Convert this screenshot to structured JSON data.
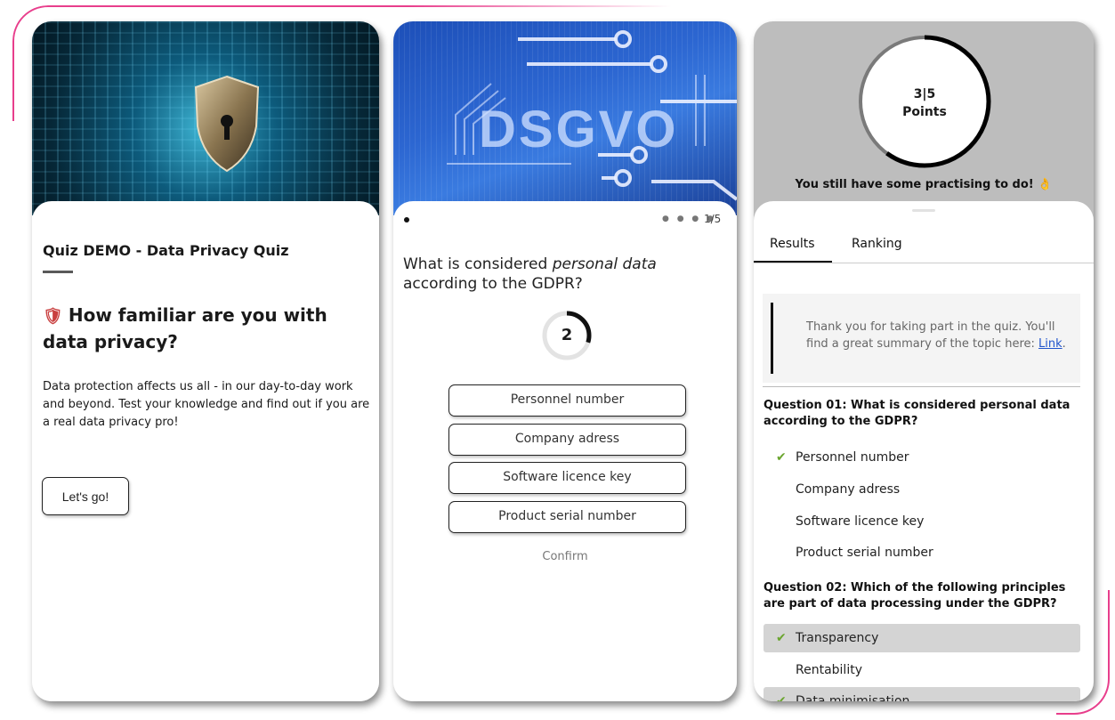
{
  "card1": {
    "title": "Quiz DEMO - Data Privacy Quiz",
    "heading_emoji": "🛡",
    "heading": "How familiar are you with data privacy?",
    "body": "Data protection affects us all - in our day-to-day work and beyond. Test your knowledge and find out if you are a real data privacy pro!",
    "start_button": "Let's go!"
  },
  "card2": {
    "image_text": "DSGVO",
    "progress_dots": "● ● ● ●",
    "step": "1/5",
    "question_pre": "What is considered ",
    "question_em": "personal data",
    "question_post": " according to the GDPR?",
    "timer": "2",
    "timer_progress": 0.3,
    "answers": [
      "Personnel number",
      "Company adress",
      "Software licence key",
      "Product serial number"
    ],
    "confirm": "Confirm"
  },
  "card3": {
    "score": "3|5",
    "score_label": "Points",
    "score_fraction": 0.6,
    "message": "You still have some practising to do!",
    "message_emoji": "👌",
    "tabs": [
      "Results",
      "Ranking"
    ],
    "thanks_text": "Thank you for taking part in the quiz. You'll find a great summary of the topic here: ",
    "thanks_link": "Link",
    "thanks_end": ".",
    "questions": [
      {
        "title": "Question 01:  What is considered personal data according to the GDPR?",
        "options": [
          {
            "label": "Personnel number",
            "correct": true,
            "selected": false
          },
          {
            "label": "Company adress",
            "correct": false,
            "selected": false
          },
          {
            "label": "Software licence key",
            "correct": false,
            "selected": false
          },
          {
            "label": "Product serial number",
            "correct": false,
            "selected": false
          }
        ]
      },
      {
        "title": "Question 02:  Which of the following principles are part of data processing under the GDPR?",
        "options": [
          {
            "label": "Transparency",
            "correct": true,
            "selected": true
          },
          {
            "label": "Rentability",
            "correct": false,
            "selected": false
          },
          {
            "label": "Data minimisation",
            "correct": true,
            "selected": true
          }
        ]
      }
    ],
    "check_mark": "✔"
  },
  "colors": {
    "accent_pink": "#e83e8c",
    "check_green": "#6aa52e",
    "link_blue": "#2255cc"
  }
}
